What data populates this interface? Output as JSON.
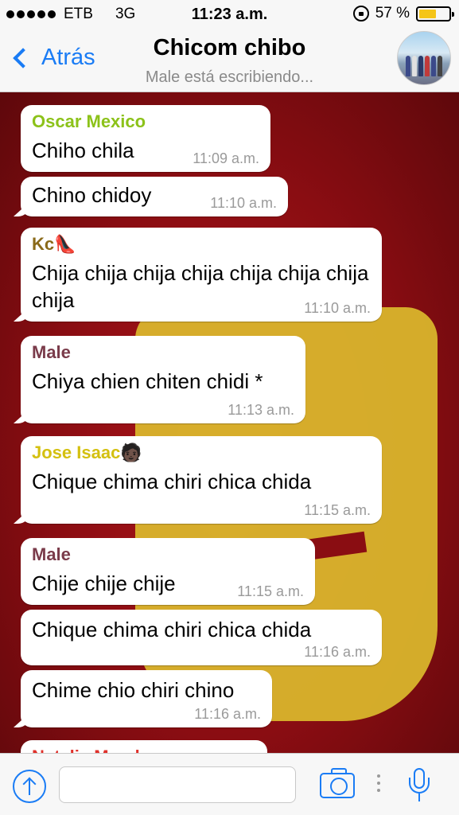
{
  "status_bar": {
    "carrier": "ETB",
    "network": "3G",
    "time": "11:23 a.m.",
    "battery_percent": "57 %",
    "battery_level": 0.57
  },
  "header": {
    "back_label": "Atrás",
    "title": "Chicom chibo",
    "subtitle": "Male  está escribiendo..."
  },
  "colors": {
    "accent": "#1a7cf5",
    "oscar": "#8cc21a",
    "kc": "#8a6a1a",
    "male": "#7a3b4a",
    "jose": "#d4c010",
    "natalia": "#e0302a"
  },
  "messages": [
    {
      "sender": "Oscar Mexico",
      "text": "Chiho chila",
      "time": "11:09 a.m."
    },
    {
      "sender": "",
      "text": "Chino chidoy",
      "time": "11:10 a.m."
    },
    {
      "sender": "Kc👠",
      "text": "Chija chija chija chija chija chija chija chija",
      "time": "11:10 a.m."
    },
    {
      "sender": "Male",
      "text": "Chiya chien chiten chidi *",
      "time": "11:13 a.m."
    },
    {
      "sender": "Jose Isaac🧑🏿",
      "text": "Chique chima chiri chica chida",
      "time": "11:15 a.m."
    },
    {
      "sender": "Male",
      "text": "Chije chije chije",
      "time": "11:15 a.m."
    },
    {
      "sender": "",
      "text": "Chique chima chiri chica chida",
      "time": "11:16 a.m."
    },
    {
      "sender": "",
      "text": "Chime chio chiri chino",
      "time": "11:16 a.m."
    },
    {
      "sender": "Natalia Mendez",
      "text": "",
      "time": ""
    }
  ],
  "input": {
    "placeholder": "",
    "value": ""
  }
}
